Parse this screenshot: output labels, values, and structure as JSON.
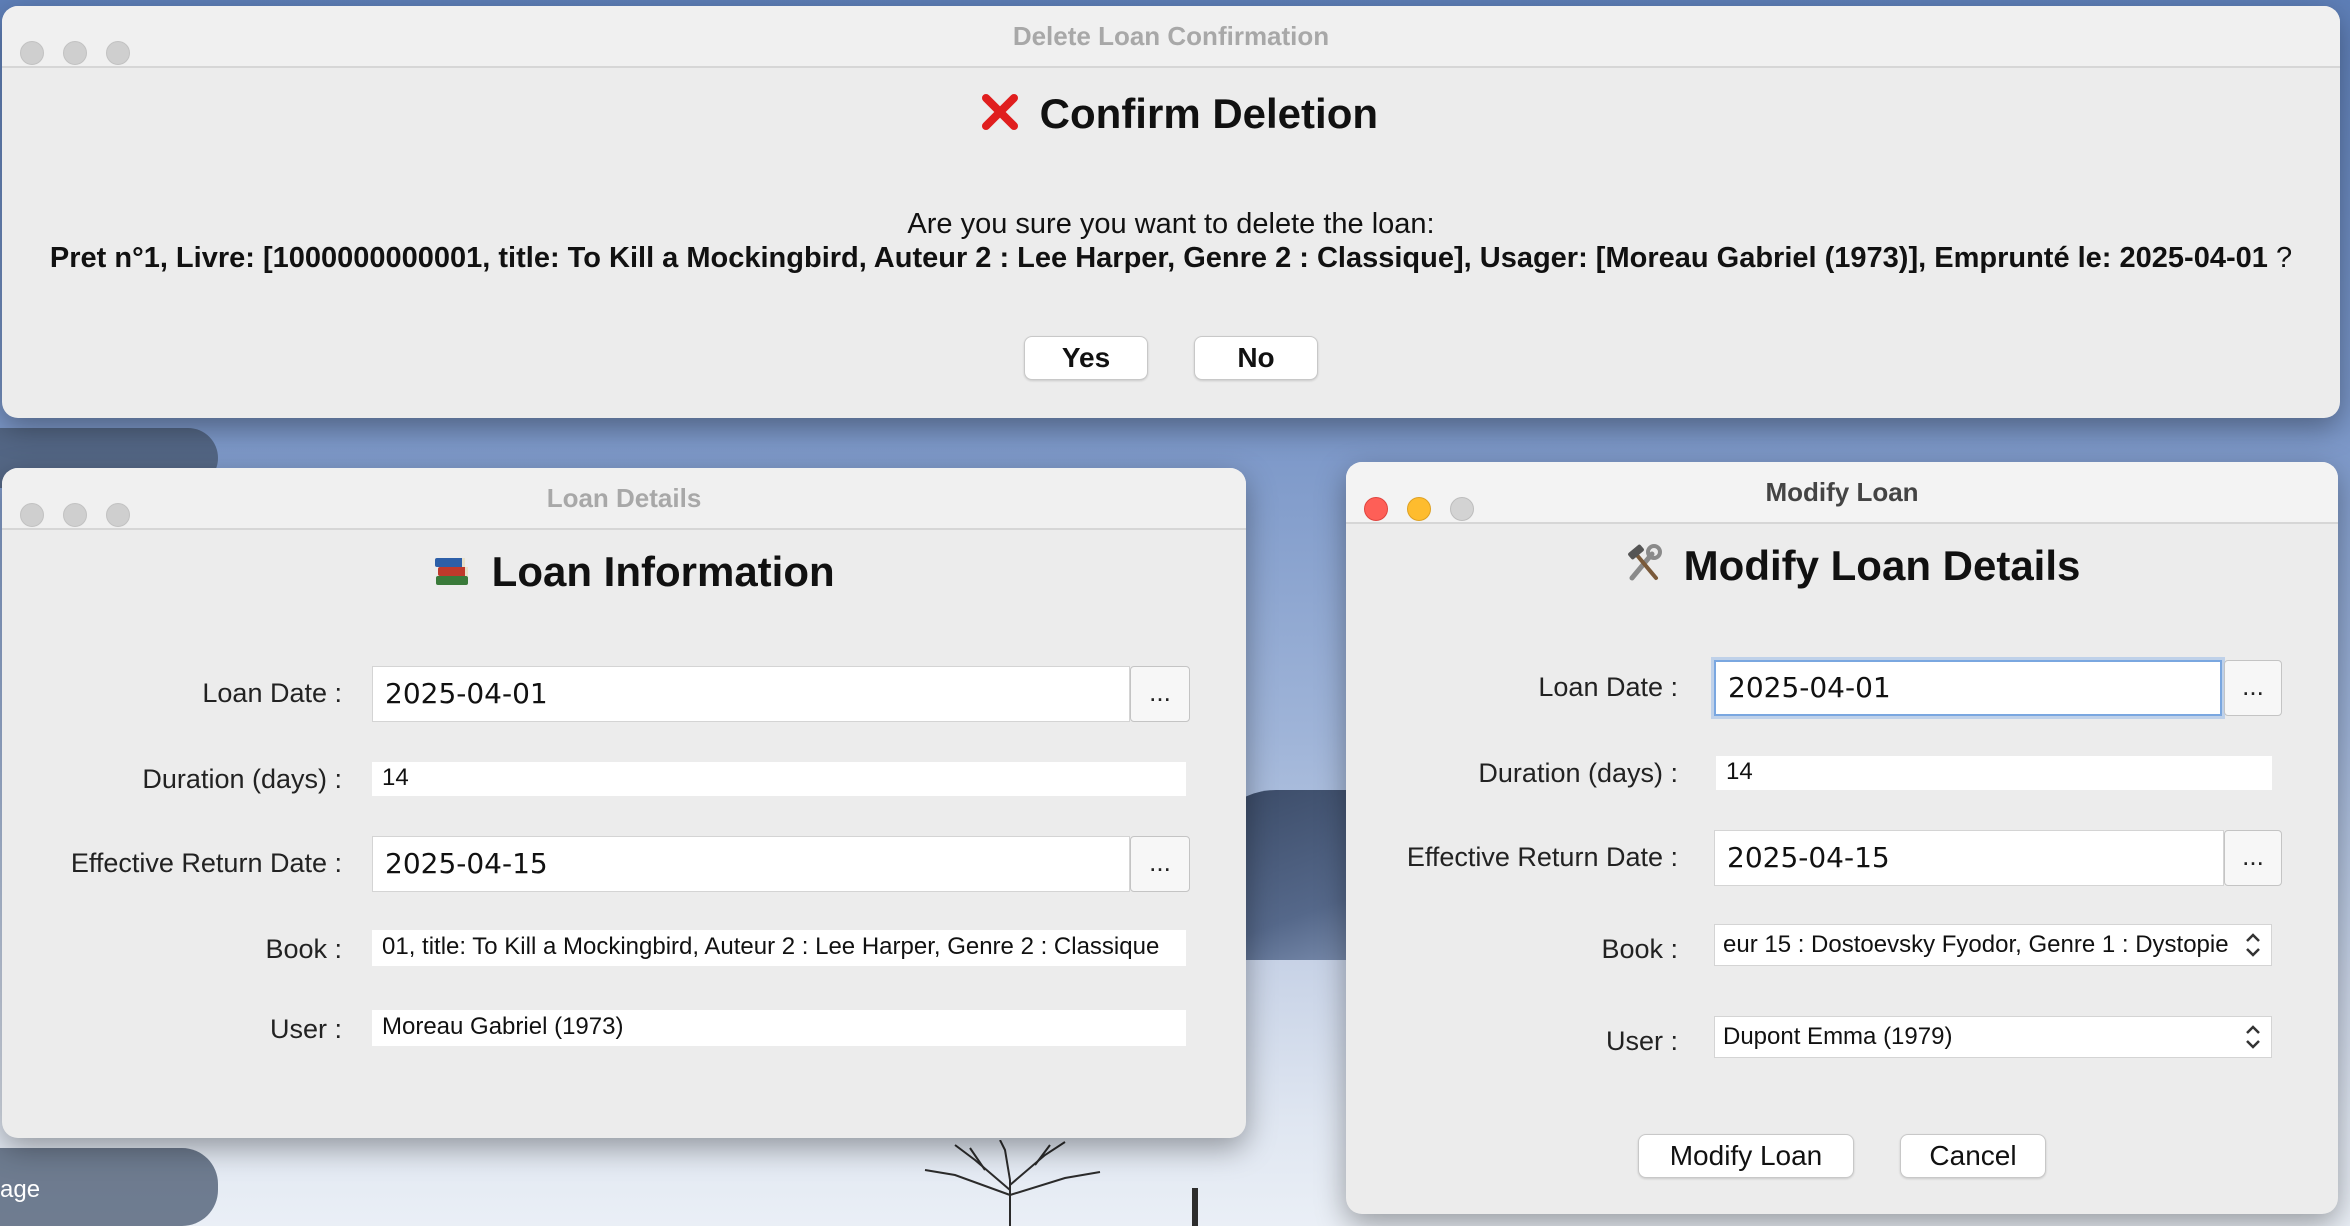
{
  "delete_dialog": {
    "title": "Delete Loan Confirmation",
    "heading_icon": "cross-mark-icon",
    "heading": "Confirm Deletion",
    "question": "Are you sure you want to delete the loan:",
    "loan_text": "Pret n°1, Livre: [1000000000001, title: To Kill a Mockingbird, Auteur 2 : Lee Harper, Genre 2 : Classique], Usager: [Moreau Gabriel (1973)], Emprunté le: 2025-04-01",
    "question_mark": "?",
    "yes_label": "Yes",
    "no_label": "No"
  },
  "details_window": {
    "title": "Loan Details",
    "heading_icon": "books-icon",
    "heading": "Loan Information",
    "loan_date_label": "Loan Date :",
    "loan_date_value": "2025-04-01",
    "duration_label": "Duration (days) :",
    "duration_value": "14",
    "return_label": "Effective Return Date :",
    "return_value": "2025-04-15",
    "book_label": "Book :",
    "book_value": "01, title: To Kill a Mockingbird, Auteur 2 : Lee Harper, Genre 2 : Classique",
    "user_label": "User :",
    "user_value": "Moreau Gabriel (1973)",
    "picker_label": "..."
  },
  "modify_window": {
    "title": "Modify Loan",
    "heading_icon": "hammer-wrench-icon",
    "heading": "Modify Loan Details",
    "loan_date_label": "Loan Date :",
    "loan_date_value": "2025-04-01",
    "duration_label": "Duration (days) :",
    "duration_value": "14",
    "return_label": "Effective Return Date :",
    "return_value": "2025-04-15",
    "book_label": "Book :",
    "book_value": "eur 15 : Dostoevsky Fyodor, Genre 1 : Dystopie",
    "user_label": "User :",
    "user_value": "Dupont Emma (1979)",
    "picker_label": "...",
    "modify_label": "Modify Loan",
    "cancel_label": "Cancel"
  },
  "background": {
    "dock_label": "age"
  }
}
